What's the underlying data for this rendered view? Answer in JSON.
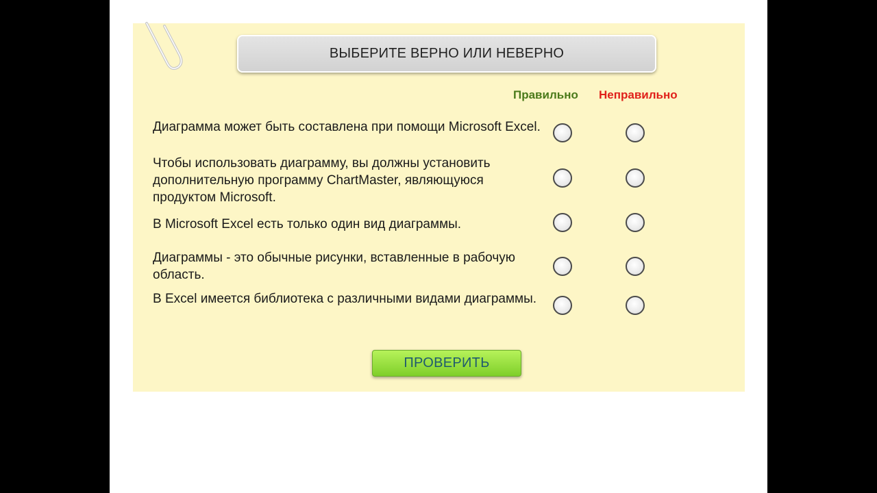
{
  "quiz": {
    "title": "ВЫБЕРИТЕ ВЕРНО ИЛИ НЕВЕРНО",
    "columns": {
      "true_label": "Правильно",
      "false_label": "Неправильно"
    },
    "questions": [
      {
        "text": "Диаграмма может быть составлена при помощи Microsoft Excel."
      },
      {
        "text": "Чтобы использовать диаграмму, вы должны установить дополнительную программу ChartMaster, являющуюся продуктом Microsoft."
      },
      {
        "text": "В Microsoft Excel есть только один вид диаграммы."
      },
      {
        "text": "Диаграммы - это обычные рисунки, вставленные в рабочую область."
      },
      {
        "text": "В Excel имеется библиотека с различными видами диаграммы."
      }
    ],
    "check_button_label": "ПРОВЕРИТЬ"
  },
  "colors": {
    "panel_background": "#fdf6c6",
    "true_header": "#4a7a1a",
    "false_header": "#e0201a",
    "check_button": "#9be243"
  }
}
